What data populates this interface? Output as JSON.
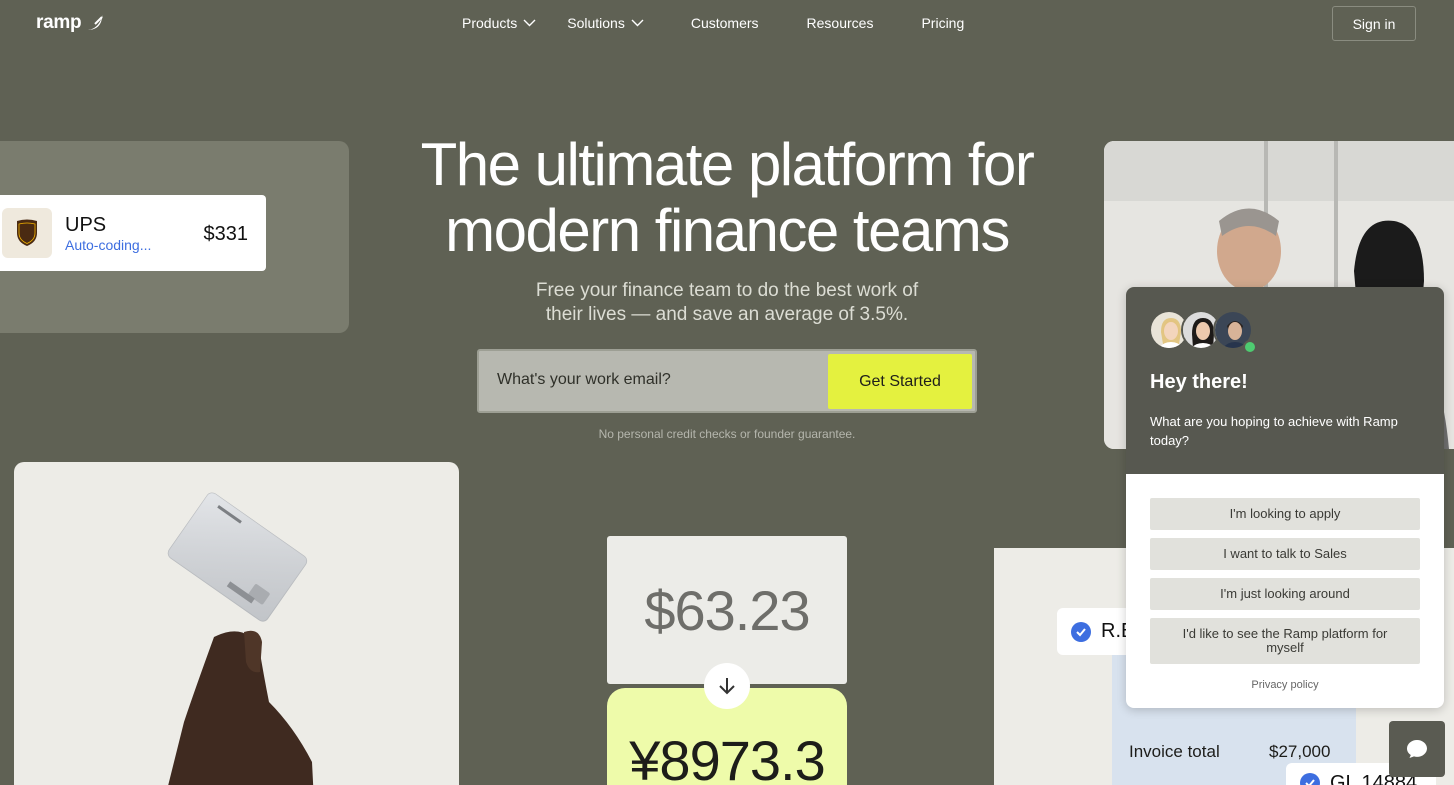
{
  "nav": {
    "logo": "ramp",
    "links": [
      "Products",
      "Solutions",
      "Customers",
      "Resources",
      "Pricing"
    ],
    "signin": "Sign in"
  },
  "hero": {
    "title_line1": "The ultimate platform for",
    "title_line2": "modern finance teams",
    "sub_line1": "Free your finance team to do the best work of",
    "sub_line2": "their lives — and save an average of 3.5%.",
    "email_placeholder": "What's your work email?",
    "cta": "Get Started",
    "disclaimer": "No personal credit checks or founder guarantee."
  },
  "ups_card": {
    "logo_text": "ups",
    "name": "UPS",
    "status": "Auto-coding...",
    "amount": "$331"
  },
  "currency": {
    "from": "$63.23",
    "to": "¥8973.3"
  },
  "invoice_card": {
    "chip": "R.E",
    "label": "Invoice total",
    "value": "$27,000",
    "gl": "GL 14884"
  },
  "chat": {
    "title": "Hey there!",
    "message": "What are you hoping to achieve with Ramp today?",
    "options": [
      "I'm looking to apply",
      "I want to talk to Sales",
      "I'm just looking around",
      "I'd like to see the Ramp platform for myself"
    ],
    "privacy": "Privacy policy"
  },
  "colors": {
    "background": "#5f6154",
    "cta": "#e4f13f",
    "accent_blue": "#3d6ee0",
    "online": "#4ecb71"
  }
}
